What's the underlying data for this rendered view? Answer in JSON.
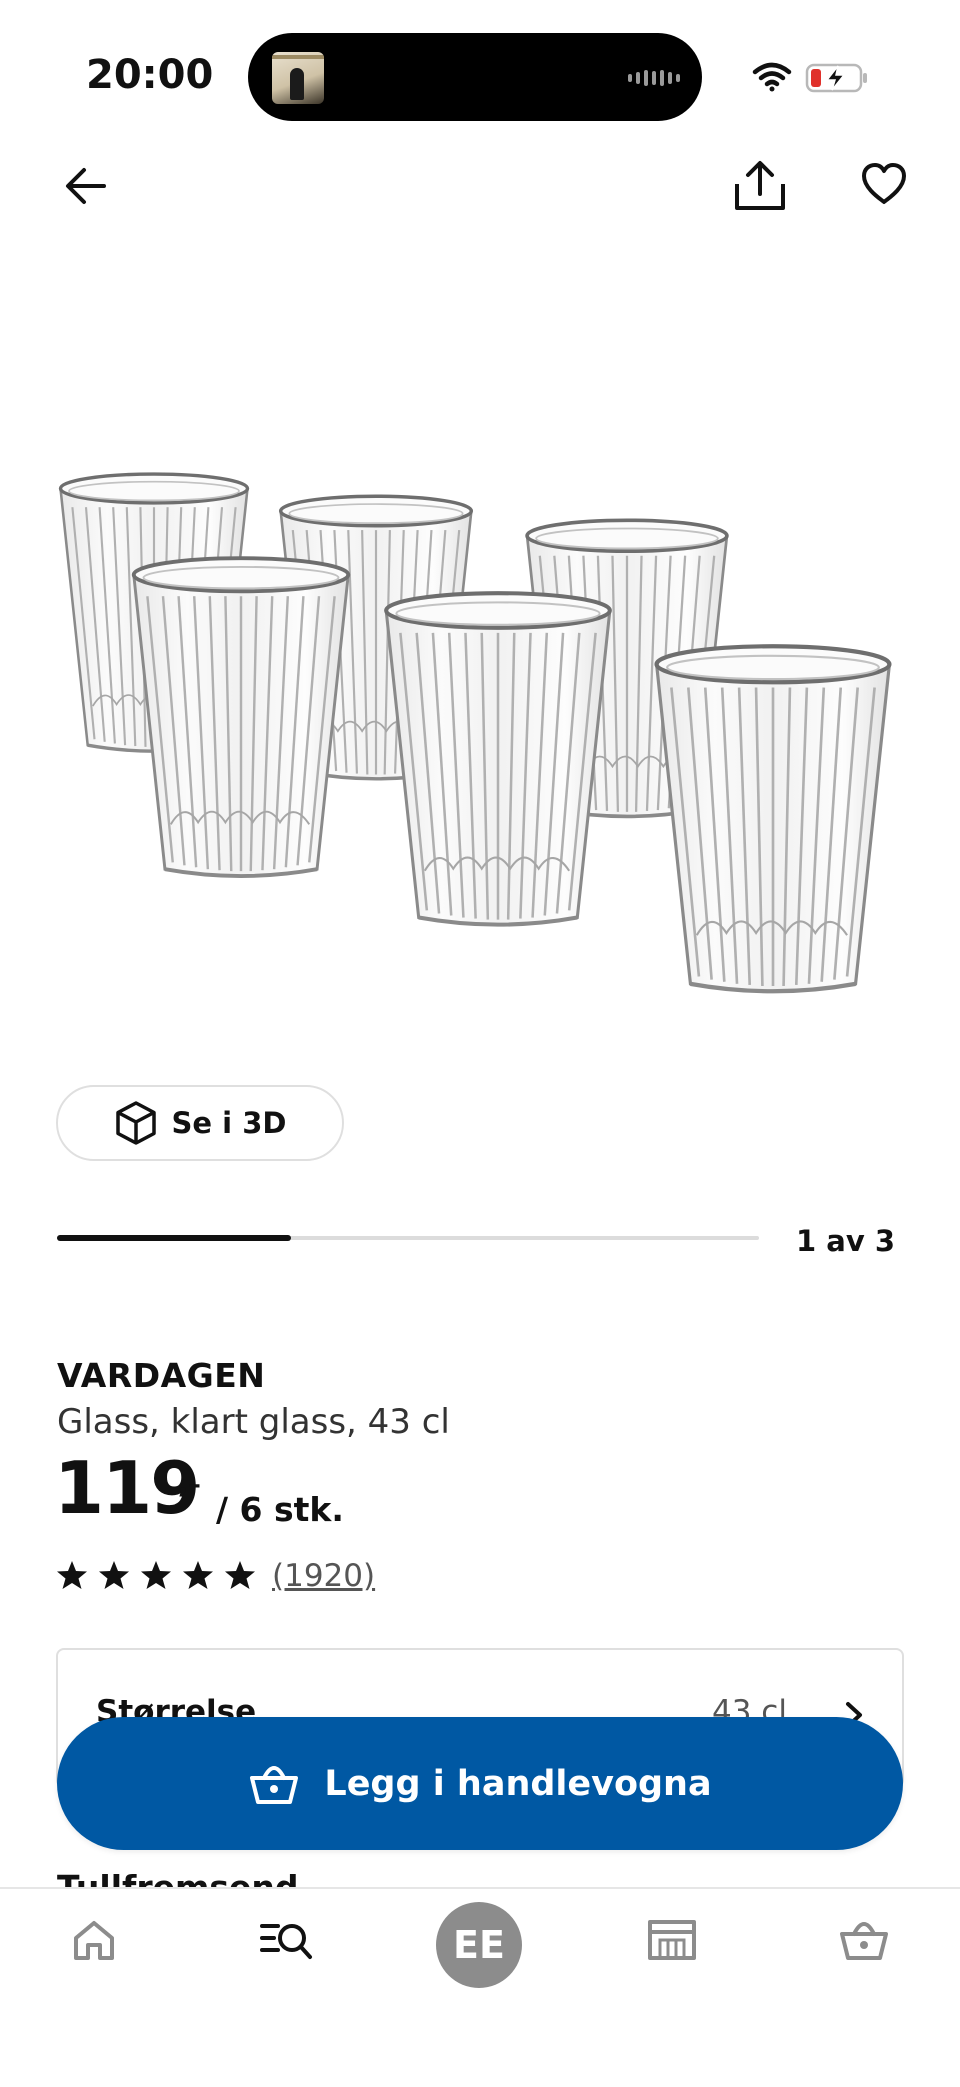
{
  "status_bar": {
    "time": "20:00",
    "wifi_icon": "wifi-icon",
    "battery_icon": "battery-charging-icon",
    "battery_color": "#e0312b"
  },
  "nav": {
    "back_icon": "arrow-left-icon",
    "share_icon": "share-icon",
    "favorite_icon": "heart-icon"
  },
  "gallery": {
    "view_3d_label": "Se i 3D",
    "counter": "1 av 3",
    "progress": 0.333
  },
  "product": {
    "name": "VARDAGEN",
    "description": "Glass, klart glass, 43 cl",
    "price_integer": "119",
    "price_decimal": ",–",
    "price_unit": "/ 6 stk.",
    "rating": 5,
    "review_count": "(1920)"
  },
  "size_selector": {
    "label": "Størrelse",
    "value": "43 cl"
  },
  "next_section": {
    "heading_partial": "Tullfremsend"
  },
  "cta": {
    "label": "Legg i handlevogna",
    "color": "#0058a3"
  },
  "tabbar": {
    "avatar_initials": "EE",
    "items": [
      "home-icon",
      "search-icon",
      "avatar",
      "store-icon",
      "basket-icon"
    ]
  }
}
